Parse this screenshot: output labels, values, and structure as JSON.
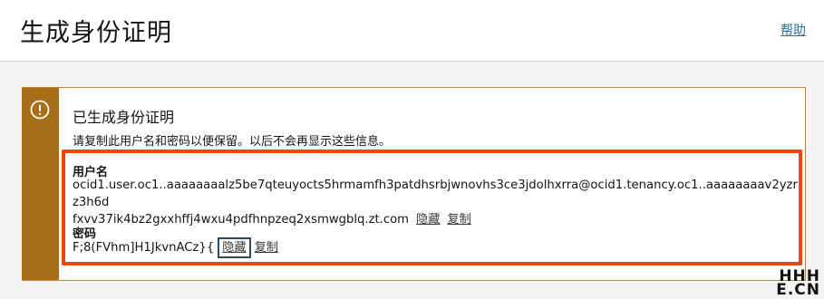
{
  "header": {
    "title": "生成身份证明",
    "help_label": "帮助"
  },
  "alert": {
    "title": "已生成身份证明",
    "description": "请复制此用户名和密码以便保留。以后不会再显示这些信息。",
    "icon": "exclamation-circle-icon",
    "accent_color": "#a86d17",
    "highlight_color": "#f0440a"
  },
  "username": {
    "label": "用户名",
    "value_line1": "ocid1.user.oc1..aaaaaaaalz5be7qteuyocts5hrmamfh3patdhsrbjwnovhs3ce3jdolhxrra@ocid1.tenancy.oc1..aaaaaaaav2yzrz3h6d",
    "value_line2": "fxvv37ik4bz2gxxhffj4wxu4pdfhnpzeq2xsmwgblq.zt.com",
    "hide_label": "隐藏",
    "copy_label": "复制"
  },
  "password": {
    "label": "密码",
    "value": "F;8(FVhm]H1JkvnACz}{",
    "hide_label": "隐藏",
    "copy_label": "复制"
  },
  "watermark": {
    "line1": "HHH",
    "line2": "E.CN"
  }
}
